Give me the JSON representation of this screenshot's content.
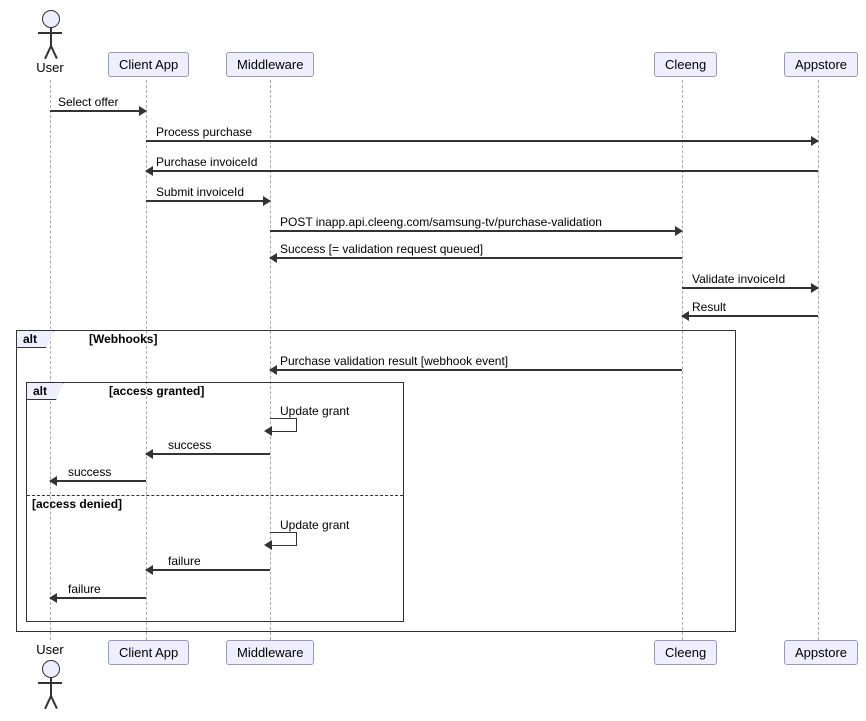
{
  "participants": {
    "user": "User",
    "client_app": "Client App",
    "middleware": "Middleware",
    "cleeng": "Cleeng",
    "appstore": "Appstore"
  },
  "messages": {
    "m1": "Select offer",
    "m2": "Process purchase",
    "m3": "Purchase invoiceId",
    "m4": "Submit invoiceId",
    "m5": "POST inapp.api.cleeng.com/samsung-tv/purchase-validation",
    "m6": "Success [= validation request queued]",
    "m7": "Validate invoiceId",
    "m8": "Result",
    "m9": "Purchase validation result [webhook event]",
    "m10": "Update grant",
    "m11": "success",
    "m12": "success",
    "m13": "Update grant",
    "m14": "failure",
    "m15": "failure"
  },
  "frames": {
    "alt1": "alt",
    "alt1_cond": "[Webhooks]",
    "alt2": "alt",
    "alt2_cond1": "[access granted]",
    "alt2_cond2": "[access denied]"
  }
}
